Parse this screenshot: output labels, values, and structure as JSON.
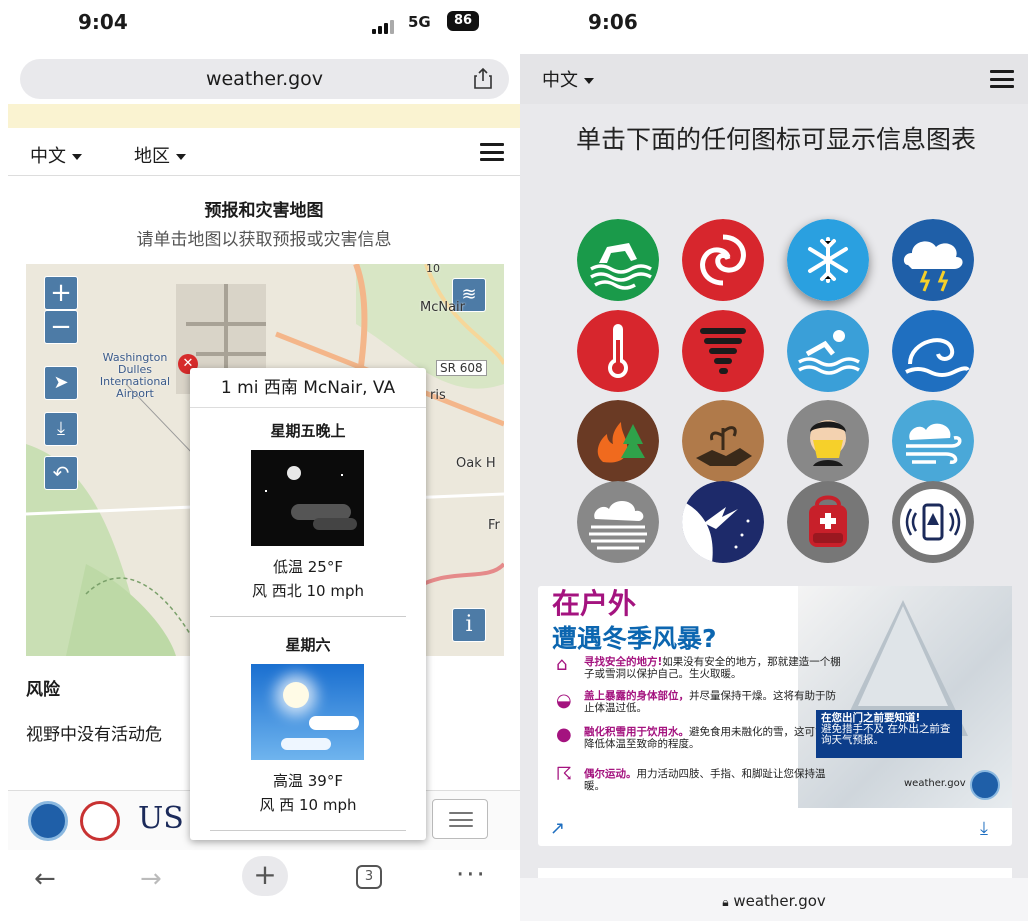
{
  "left": {
    "status": {
      "time": "9:04",
      "network": "5G",
      "battery": "86"
    },
    "address_bar": {
      "url": "weather.gov"
    },
    "header": {
      "language_label": "中文",
      "region_label": "地区"
    },
    "map_section": {
      "title": "预报和灾害地图",
      "subtitle": "请单击地图以获取预报或灾害信息",
      "map_labels": [
        "McNair",
        "SR 608",
        "Washington Dulles International Airport",
        "Oak H",
        "ris",
        "Fr",
        "10"
      ],
      "controls": [
        "zoom-in",
        "zoom-out",
        "locate",
        "download",
        "back",
        "layers",
        "info"
      ]
    },
    "forecast_popup": {
      "location": "1 mi 西南 McNair, VA",
      "periods": [
        {
          "name": "星期五晚上",
          "temp": "低温 25°F",
          "wind": "风 西北 10 mph",
          "icon": "night-clear-icon"
        },
        {
          "name": "星期六",
          "temp": "高温 39°F",
          "wind": "风 西 10 mph",
          "icon": "sunny-icon"
        }
      ]
    },
    "risk": {
      "heading": "风险",
      "text": "视野中没有活动危"
    },
    "browser_nav": {
      "tab_count": "3"
    }
  },
  "right": {
    "status": {
      "time": "9:06"
    },
    "header": {
      "language_label": "中文"
    },
    "instruction": "单击下面的任何图标可显示信息图表",
    "icons": [
      {
        "name": "flood-icon",
        "color": "#1a9a4a"
      },
      {
        "name": "hurricane-icon",
        "color": "#d7262d"
      },
      {
        "name": "snowflake-icon",
        "color": "#2aa0e0"
      },
      {
        "name": "thunderstorm-icon",
        "color": "#1f5fa8"
      },
      {
        "name": "heat-thermometer-icon",
        "color": "#d7262d"
      },
      {
        "name": "tornado-icon",
        "color": "#d7262d"
      },
      {
        "name": "swimming-icon",
        "color": "#3a9fd8"
      },
      {
        "name": "waves-icon",
        "color": "#1f6fc0"
      },
      {
        "name": "wildfire-icon",
        "color": "#6a3a24"
      },
      {
        "name": "drought-icon",
        "color": "#b07a4a"
      },
      {
        "name": "air-quality-mask-icon",
        "color": "#888888"
      },
      {
        "name": "wind-icon",
        "color": "#4aa8d8"
      },
      {
        "name": "fog-icon",
        "color": "#888888"
      },
      {
        "name": "space-weather-icon",
        "color": "#1d2a6a"
      },
      {
        "name": "emergency-kit-icon",
        "color": "#777777"
      },
      {
        "name": "wireless-alert-icon",
        "color": "#777777"
      }
    ],
    "infographic": {
      "title_line1": "在户外",
      "title_line2": "遭遇冬季风暴?",
      "items": [
        {
          "bold": "寻找安全的地方!",
          "text": "如果没有安全的地方，那就建造一个棚子或雪洞以保护自己。生火取暖。"
        },
        {
          "bold": "盖上暴露的身体部位，",
          "text": "并尽量保持干燥。这将有助于防止体温过低。"
        },
        {
          "bold": "融化积雪用于饮用水。",
          "text": "避免食用未融化的雪，这可能会降低体温至致命的程度。"
        },
        {
          "bold": "偶尔运动。",
          "text": "用力活动四肢、手指、和脚趾让您保持温暖。"
        }
      ],
      "box_title": "在您出门之前要知道!",
      "box_text": "避免措手不及 在外出之前查询天气预报。",
      "brand": "weather.gov"
    },
    "bottom_url": "weather.gov"
  }
}
